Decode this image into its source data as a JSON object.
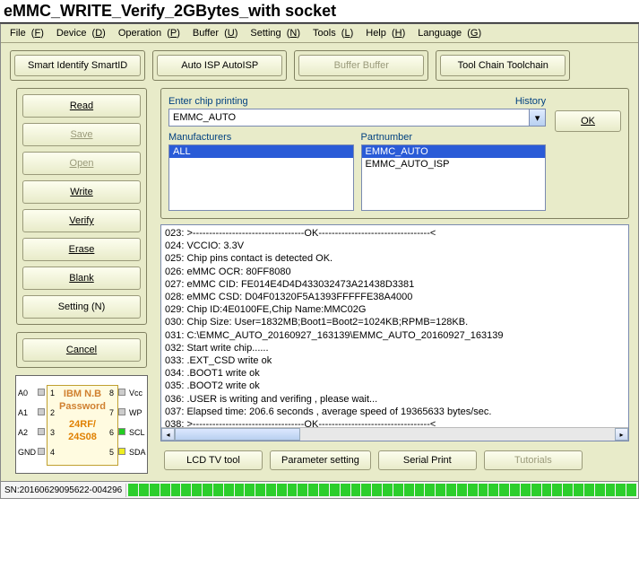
{
  "title": "eMMC_WRITE_Verify_2GBytes_with socket",
  "menu": [
    {
      "label": "File",
      "key": "F"
    },
    {
      "label": "Device",
      "key": "D"
    },
    {
      "label": "Operation",
      "key": "P"
    },
    {
      "label": "Buffer",
      "key": "U"
    },
    {
      "label": "Setting",
      "key": "N"
    },
    {
      "label": "Tools",
      "key": "L"
    },
    {
      "label": "Help",
      "key": "H"
    },
    {
      "label": "Language",
      "key": "G"
    }
  ],
  "topButtons": {
    "smart": "Smart Identify SmartID",
    "autoisp": "Auto ISP AutoISP",
    "buffer": "Buffer Buffer",
    "toolchain": "Tool Chain Toolchain"
  },
  "leftButtons": {
    "read": "Read",
    "save": "Save",
    "open": "Open",
    "write": "Write",
    "verify": "Verify",
    "erase": "Erase",
    "blank": "Blank",
    "setting": "Setting (N)",
    "cancel": "Cancel"
  },
  "chipDiagram": {
    "line1": "IBM  N.B",
    "line2": "Password",
    "line3a": "24RF/",
    "line3b": "24S08",
    "leftPins": [
      "A0",
      "A1",
      "A2",
      "GND"
    ],
    "leftNums": [
      "1",
      "2",
      "3",
      "4"
    ],
    "rightNums": [
      "8",
      "7",
      "6",
      "5"
    ],
    "rightPins": [
      "Vcc",
      "WP",
      "SCL",
      "SDA"
    ]
  },
  "chipSelect": {
    "enterLabel": "Enter chip printing",
    "historyLabel": "History",
    "chipValue": "EMMC_AUTO",
    "okLabel": "OK",
    "manuLabel": "Manufacturers",
    "manuItems": [
      "ALL"
    ],
    "partLabel": "Partnumber",
    "partItems": [
      "EMMC_AUTO",
      "EMMC_AUTO_ISP"
    ]
  },
  "log": [
    "023:  >----------------------------------OK----------------------------------<",
    "024:  VCCIO: 3.3V",
    "025:  Chip pins contact is detected OK.",
    "026:  eMMC OCR: 80FF8080",
    "027:  eMMC CID:  FE014E4D4D433032473A21438D3381",
    "028:  eMMC CSD: D04F01320F5A1393FFFFFE38A4000",
    "029:  Chip ID:4E0100FE,Chip Name:MMC02G",
    "030:  Chip Size: User=1832MB;Boot1=Boot2=1024KB;RPMB=128KB.",
    "031:  C:\\EMMC_AUTO_20160927_163139\\EMMC_AUTO_20160927_163139",
    "032:  Start write chip......",
    "033:  .EXT_CSD write ok",
    "034:  .BOOT1 write ok",
    "035:  .BOOT2 write ok",
    "036:  .USER  is writing and verifing , please wait...",
    "037:  Elapsed time: 206.6 seconds , average speed of 19365633 bytes/sec.",
    "038:  >----------------------------------OK----------------------------------<"
  ],
  "bottomButtons": {
    "lcd": "LCD TV tool",
    "param": "Parameter setting",
    "serial": "Serial Print",
    "tut": "Tutorials"
  },
  "status": {
    "sn": "SN:20160629095622-004296"
  }
}
